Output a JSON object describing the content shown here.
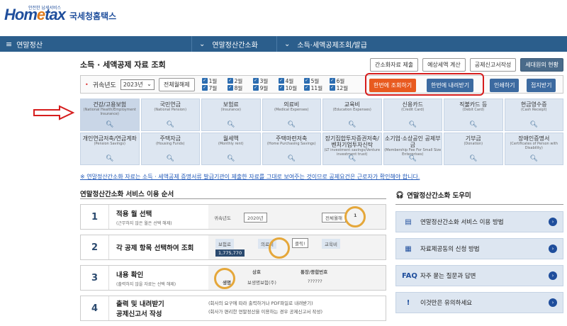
{
  "header": {
    "logo_small": "안전한 납세서비스",
    "logo_en_1": "Hom",
    "logo_en_2": "e",
    "logo_en_3": "tax",
    "logo_kr": "국세청홈택스"
  },
  "nav": {
    "menu_icon": "hamburger-icon",
    "items": [
      "연말정산",
      "연말정산간소화",
      "소득·세액공제조회/발급"
    ]
  },
  "page": {
    "title": "소득 · 세액공제 자료 조회",
    "buttons": [
      "간소화자료 제출",
      "예상세액 계산",
      "공제신고서작성",
      "세대원의 현황"
    ]
  },
  "filter": {
    "year_label": "귀속년도",
    "year_value": "2023년",
    "select_all": "전체월해제",
    "months": [
      "1월",
      "3월",
      "5월",
      "7월",
      "9월",
      "11월",
      "2월",
      "4월",
      "6월",
      "8월",
      "10월",
      "12월"
    ],
    "actions": [
      "한번에 조회하기",
      "한번에 내려받기",
      "인쇄하기",
      "접지받기"
    ]
  },
  "categories": [
    {
      "kr": "건강/고용보험",
      "en": "(National Health/Employment Insurance)"
    },
    {
      "kr": "국민연금",
      "en": "(National Pension)"
    },
    {
      "kr": "보험료",
      "en": "(Insurance)"
    },
    {
      "kr": "의료비",
      "en": "(Medical Expenses)"
    },
    {
      "kr": "교육비",
      "en": "(Education Expenses)"
    },
    {
      "kr": "신용카드",
      "en": "(Credit Card)"
    },
    {
      "kr": "직불카드 등",
      "en": "(Debit Card)"
    },
    {
      "kr": "현금영수증",
      "en": "(Cash Receipt)"
    },
    {
      "kr": "개인연금저축/연금계좌",
      "en": "(Pension Savings)"
    },
    {
      "kr": "주택자금",
      "en": "(Housing Funds)"
    },
    {
      "kr": "월세액",
      "en": "(Monthly rent)"
    },
    {
      "kr": "주택마련저축",
      "en": "(Home Purchasing Savings)"
    },
    {
      "kr": "장기집합투자증권저축/벤처기업투자신탁",
      "en": "(LT investment savings/Venture investment trust)"
    },
    {
      "kr": "소기업·소상공인 공제부금",
      "en": "(Membership Fee For Small Size Enterprises)"
    },
    {
      "kr": "기부금",
      "en": "(Donation)"
    },
    {
      "kr": "장애인증명서",
      "en": "(Certificates of Person with Disability)"
    }
  ],
  "notice": "※ 연말정산간소화 자료는 소득 · 세액공제 증명서류 발급기관이 제출한 자료를 그대로 보여주는 것이므로 공제요건은 근로자가 확인해야 합니다.",
  "steps": {
    "title": "연말정산간소화 서비스 이용 순서",
    "items": [
      {
        "num": "1",
        "title": "적용 월 선택",
        "sub": "(근무하지 않은 월은 선택 해제)",
        "img1": "귀속년도",
        "img2": "2020년",
        "img3": "전체월해",
        "img4": "1"
      },
      {
        "num": "2",
        "title": "각 공제 항목 선택하여 조회",
        "sub": "",
        "img1": "보험료",
        "img2": "의료비",
        "img3": "클릭!",
        "img4": "1,775,770",
        "img5": "교육비"
      },
      {
        "num": "3",
        "title": "내용 확인",
        "sub": "(출력하지 않을 자료는 선택 해제)",
        "img1": "상호",
        "img2": "통장/종합번호",
        "img3": "생명",
        "img4": "보생명보험(주)",
        "img5": "??????"
      },
      {
        "num": "4",
        "title": "출력 및 내려받기",
        "sub": "공제신고서 작성",
        "img1": "(회사의 요구에 따라 출력하거나 PDF파일로 내려받기)",
        "img2": "(회사가 편리한 연말정산을 이용하는 경우 공제신고서 작성)"
      }
    ]
  },
  "help": {
    "title": "연말정산간소화 도우미",
    "items": [
      {
        "icon": "document-icon",
        "label": "연말정산간소화 서비스 이용 방법"
      },
      {
        "icon": "form-icon",
        "label": "자료제공동의 신청 방법"
      },
      {
        "icon": "faq-icon",
        "label": "자주 묻는 질문과 답변"
      },
      {
        "icon": "alert-icon",
        "label": "이것만은 유의하세요"
      }
    ]
  }
}
